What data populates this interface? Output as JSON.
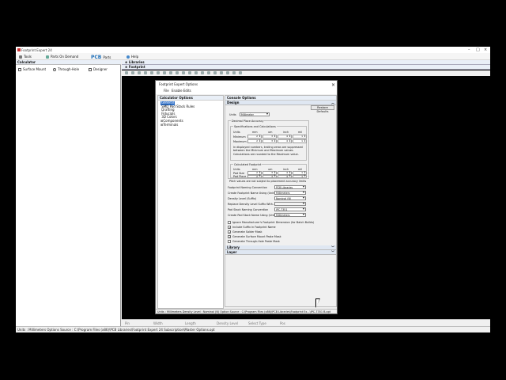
{
  "app": {
    "title": "Footprint Expert 24",
    "menu": [
      {
        "label": "Tools",
        "icon": "tools-icon"
      },
      {
        "label": "Parts On Demand",
        "icon": "parts-on-demand-icon"
      },
      {
        "label": "Parts",
        "icon": "pcb-logo-icon",
        "logo": "PCB"
      },
      {
        "label": "Help",
        "icon": "help-icon"
      }
    ]
  },
  "calculator_panel": {
    "title": "Calculator",
    "tabs": [
      "Surface Mount",
      "Through-Hole",
      "Designer"
    ]
  },
  "right_tabs": [
    "Libraries",
    "Footprint"
  ],
  "bottom_strip": [
    "Pin",
    "Width",
    "Length",
    "Density Level",
    "Select Type",
    "Pos"
  ],
  "status_bar": "Units : Millimeters   Options Source : C:\\Program Files (x86)\\PCB Libraries\\Footprint Expert 24 Subscription\\Master Options.opt",
  "dialog": {
    "title": "Footprint Expert Options",
    "menu": [
      "File",
      "Enable Edits"
    ],
    "calc_options": {
      "title": "Calculator Options",
      "tree": [
        "General",
        "SMD Pad Stack Rules",
        "Drafting",
        "Fiducials",
        "3D Colors",
        "Components",
        "Terminals"
      ],
      "selected": "General"
    },
    "console": {
      "title": "Console Options",
      "design_header": "Design",
      "restore_label": "Restore Defaults",
      "units_label": "Units",
      "units_value": "Millimeter",
      "decimal_group": "Decimal Place Accuracy",
      "spec_group": "Specifications and Calculations",
      "col_headers": [
        "Units",
        "mm",
        "um",
        "inch",
        "mil"
      ],
      "row_labels": [
        "Minimum",
        "Maximum"
      ],
      "spec_values": [
        [
          "2",
          "3",
          "4",
          "1"
        ],
        [
          "2",
          "3",
          "4",
          "1"
        ]
      ],
      "note1": "In displayed numbers, trailing zeros are suppressed between the Minimum and Maximum values.",
      "note1b": "Calculations are rounded to the Maximum value.",
      "calc_footprint_group": "Calculated Footprint",
      "fp_row_labels": [
        "Pad Size",
        "Pad Place"
      ],
      "fp_values": [
        [
          "2",
          "3",
          "4",
          "1"
        ],
        [
          "2",
          "3",
          "4",
          "1"
        ]
      ],
      "note2": "Pitch values are not subject to placement accuracy limits",
      "settings": [
        {
          "label": "Footprint Naming Convention",
          "value": "PCB Libraries"
        },
        {
          "label": "Create Footprint Name Using (Units)",
          "value": "Millimeters"
        },
        {
          "label": "Density Level (Suffix)",
          "value": "Nominal (N)"
        },
        {
          "label": "Replace Density Level Suffix With...",
          "value": ""
        },
        {
          "label": "Pad Stack Naming Convention",
          "value": "IPC-7351"
        },
        {
          "label": "Create Pad Stack Name Using (Units)",
          "value": "Millimeters"
        }
      ],
      "checks": [
        {
          "label": "Ignore Manufacturer's Footprint Dimension (for Batch Builds)",
          "checked": false
        },
        {
          "label": "Include Suffix in Footprint Name",
          "checked": true
        },
        {
          "label": "Generate Solder Mask",
          "checked": true
        },
        {
          "label": "Generate Surface Mount Paste Mask",
          "checked": true
        },
        {
          "label": "Generate Through-Hole Paste Mask",
          "checked": false
        }
      ],
      "sections": [
        "Library",
        "Layer"
      ]
    },
    "status": "Units : Millimeters   Density Level : Nominal (N)   Option Source : C:\\Program Files (x86)\\PCB Libraries\\Footprint Ex...\\IPC-7351 B.opt"
  },
  "colors": {
    "selection": "#2e6fc7",
    "brand": "#1f6fb8"
  }
}
